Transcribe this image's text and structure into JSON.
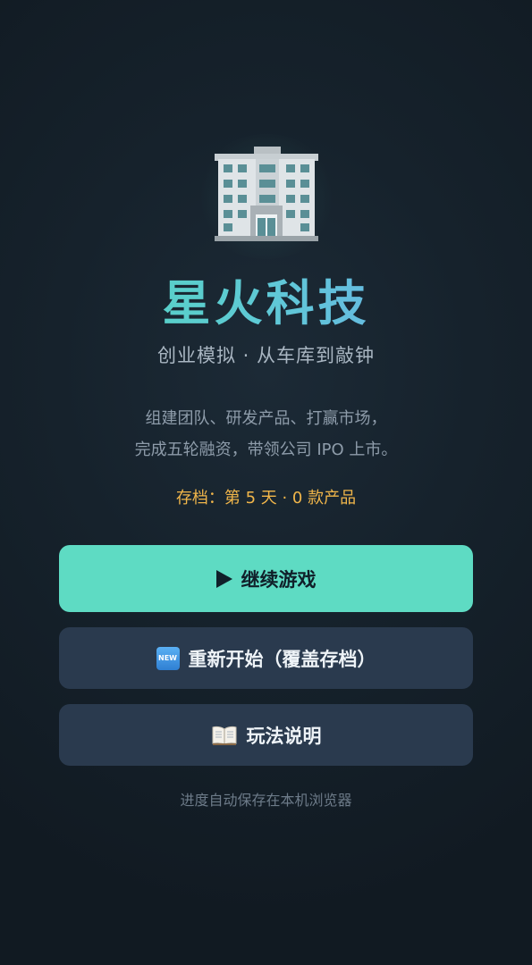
{
  "app": {
    "logo_icon": "office-building-icon",
    "title": "星火科技",
    "subtitle": "创业模拟 · 从车库到敲钟",
    "description": [
      "组建团队、研发产品、打赢市场，",
      "完成五轮融资，带领公司 IPO 上市。"
    ],
    "save_info": "存档：第 5 天 · 0 款产品"
  },
  "buttons": {
    "continue": {
      "icon": "play-icon",
      "label": "继续游戏"
    },
    "restart": {
      "icon": "new-badge-icon",
      "badge_text": "NEW",
      "label": "重新开始（覆盖存档）"
    },
    "guide": {
      "icon": "open-book-icon",
      "label": "玩法说明"
    }
  },
  "footer": "进度自动保存在本机浏览器",
  "colors": {
    "background": "#16222c",
    "accent": "#5edbc3",
    "title_gradient": [
      "#4fd9b6",
      "#6fa8ee"
    ],
    "save_info": "#f1b64a",
    "secondary_button": "#2a3a4e"
  }
}
